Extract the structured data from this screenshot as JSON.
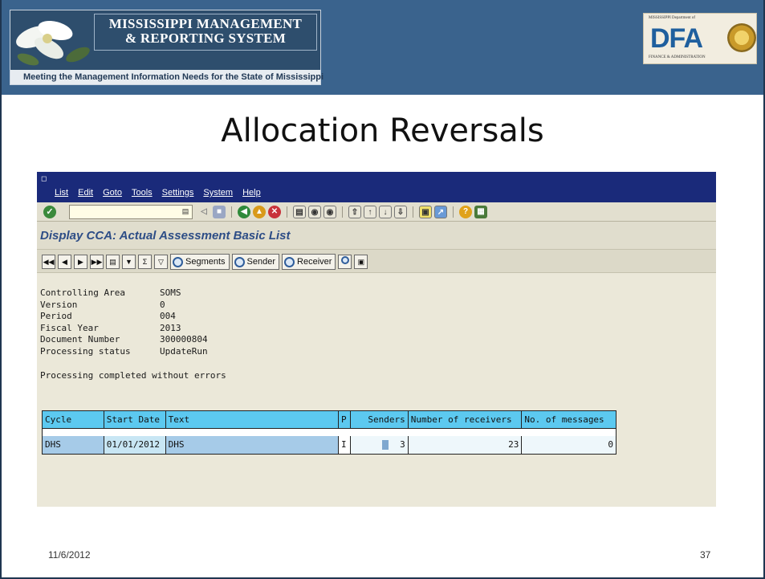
{
  "header": {
    "logo_line1": "MISSISSIPPI MANAGEMENT",
    "logo_line2": "& REPORTING SYSTEM",
    "tagline": "Meeting the Management Information Needs for the State of Mississippi",
    "dfa_top": "MISSISSIPPI Department of",
    "dfa_letters": "DFA",
    "dfa_bottom": "FINANCE & ADMINISTRATION"
  },
  "slide": {
    "title": "Allocation Reversals",
    "date": "11/6/2012",
    "page_number": "37"
  },
  "sap": {
    "menu": [
      "List",
      "Edit",
      "Goto",
      "Tools",
      "Settings",
      "System",
      "Help"
    ],
    "command_value": "",
    "screen_title": "Display CCA: Actual Assessment Basic List",
    "app_buttons": {
      "segments": "Segments",
      "sender": "Sender",
      "receiver": "Receiver"
    },
    "info": [
      {
        "label": "Controlling Area",
        "value": "SOMS"
      },
      {
        "label": "Version",
        "value": "0"
      },
      {
        "label": "Period",
        "value": "004"
      },
      {
        "label": "Fiscal Year",
        "value": "2013"
      },
      {
        "label": "Document Number",
        "value": "300000804"
      },
      {
        "label": "Processing status",
        "value": "UpdateRun"
      }
    ],
    "status_message": "Processing completed without errors",
    "table": {
      "headers": [
        "Cycle",
        "Start Date",
        "Text",
        "P",
        "Senders",
        "Number of receivers",
        "No. of messages"
      ],
      "rows": [
        [
          "DHS",
          "01/01/2012",
          "DHS",
          "I",
          "3",
          "23",
          "0"
        ]
      ]
    }
  }
}
